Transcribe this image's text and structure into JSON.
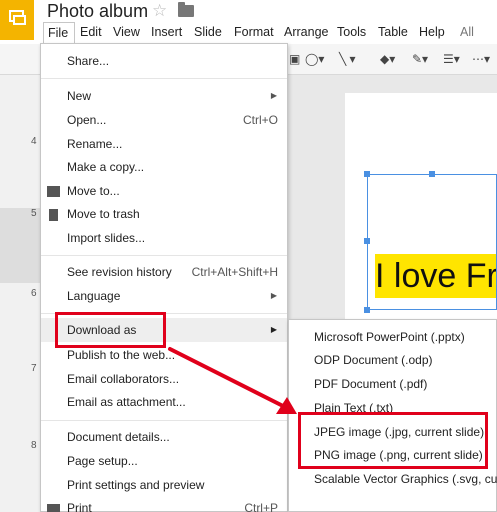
{
  "header": {
    "title": "Photo album"
  },
  "menubar": {
    "items": [
      "File",
      "Edit",
      "View",
      "Insert",
      "Slide",
      "Format",
      "Arrange",
      "Tools",
      "Table",
      "Help",
      "All cha"
    ]
  },
  "thumbnails": {
    "numbers": [
      "4",
      "5",
      "6",
      "7",
      "8"
    ]
  },
  "slide": {
    "text": "I love Fre"
  },
  "file_menu": {
    "share": "Share...",
    "new": "New",
    "open": "Open...",
    "open_shortcut": "Ctrl+O",
    "rename": "Rename...",
    "make_copy": "Make a copy...",
    "move_to": "Move to...",
    "move_to_trash": "Move to trash",
    "import_slides": "Import slides...",
    "revision_history": "See revision history",
    "revision_shortcut": "Ctrl+Alt+Shift+H",
    "language": "Language",
    "download_as": "Download as",
    "publish": "Publish to the web...",
    "email_collaborators": "Email collaborators...",
    "email_attachment": "Email as attachment...",
    "document_details": "Document details...",
    "page_setup": "Page setup...",
    "print_settings": "Print settings and preview",
    "print": "Print",
    "print_shortcut": "Ctrl+P"
  },
  "download_submenu": {
    "items": [
      "Microsoft PowerPoint (.pptx)",
      "ODP Document (.odp)",
      "PDF Document (.pdf)",
      "Plain Text (.txt)",
      "JPEG image (.jpg, current slide)",
      "PNG image (.png, current slide)",
      "Scalable Vector Graphics (.svg, curr"
    ]
  },
  "colors": {
    "highlight": "#e0001b",
    "logo": "#f4b400",
    "selection": "#4a90e2",
    "text_highlight": "#ffe500"
  }
}
